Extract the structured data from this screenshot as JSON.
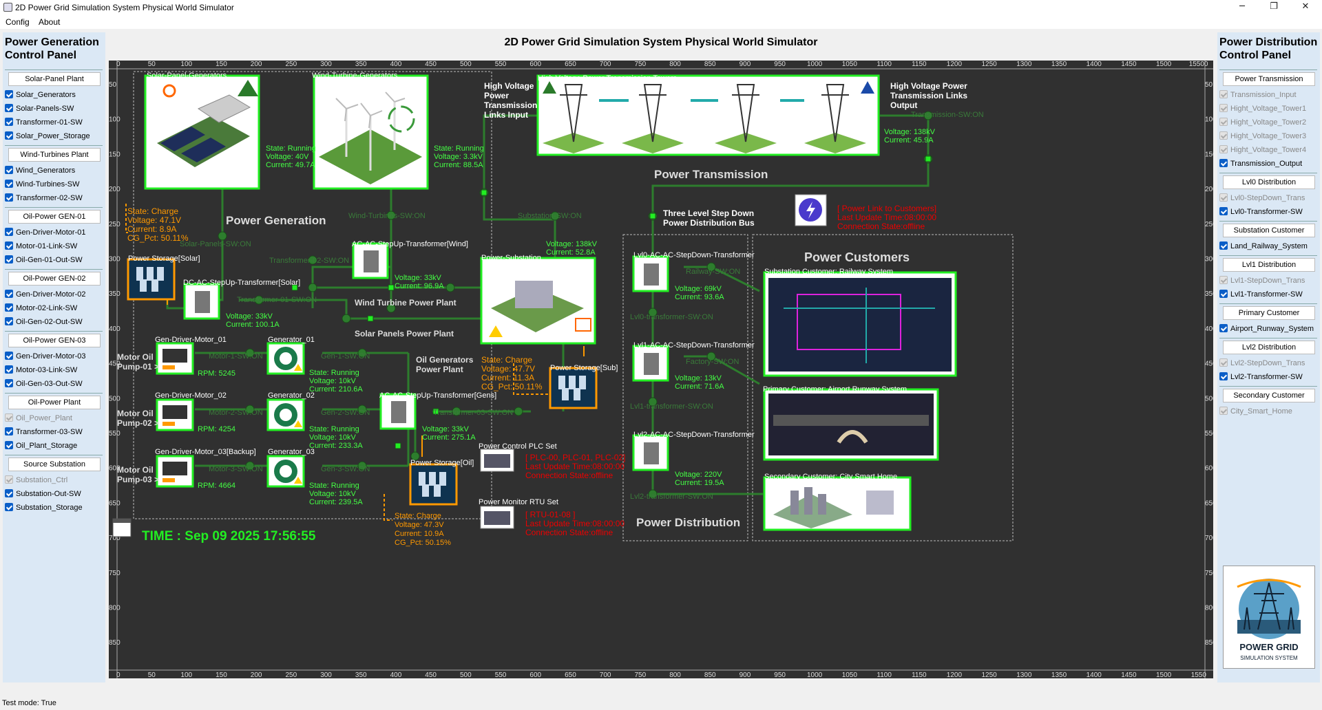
{
  "window": {
    "title": "2D Power Grid Simulation System Physical World Simulator",
    "min": "─",
    "max": "❐",
    "close": "✕"
  },
  "menu": [
    "Config",
    "About"
  ],
  "main_title": "2D Power Grid Simulation System Physical World Simulator",
  "left_panel": {
    "title_line1": "Power Generation",
    "title_line2": "Control Panel",
    "groups": [
      {
        "button": "Solar-Panel Plant",
        "items": [
          {
            "label": "Solar_Generators",
            "state": "on"
          },
          {
            "label": "Solar-Panels-SW",
            "state": "on"
          },
          {
            "label": "Transformer-01-SW",
            "state": "on"
          },
          {
            "label": "Solar_Power_Storage",
            "state": "on"
          }
        ]
      },
      {
        "button": "Wind-Turbines Plant",
        "items": [
          {
            "label": "Wind_Generators",
            "state": "on"
          },
          {
            "label": "Wind-Turbines-SW",
            "state": "on"
          },
          {
            "label": "Transformer-02-SW",
            "state": "on"
          }
        ]
      },
      {
        "button": "Oil-Power GEN-01",
        "items": [
          {
            "label": "Gen-Driver-Motor-01",
            "state": "on"
          },
          {
            "label": "Motor-01-Link-SW",
            "state": "on"
          },
          {
            "label": "Oil-Gen-01-Out-SW",
            "state": "on"
          }
        ]
      },
      {
        "button": "Oil-Power GEN-02",
        "items": [
          {
            "label": "Gen-Driver-Motor-02",
            "state": "on"
          },
          {
            "label": "Motor-02-Link-SW",
            "state": "on"
          },
          {
            "label": "Oil-Gen-02-Out-SW",
            "state": "on"
          }
        ]
      },
      {
        "button": "Oil-Power GEN-03",
        "items": [
          {
            "label": "Gen-Driver-Motor-03",
            "state": "on"
          },
          {
            "label": "Motor-03-Link-SW",
            "state": "on"
          },
          {
            "label": "Oil-Gen-03-Out-SW",
            "state": "on"
          }
        ]
      },
      {
        "button": "Oil-Power Plant",
        "items": [
          {
            "label": "Oil_Power_Plant",
            "state": "dis"
          },
          {
            "label": "Transformer-03-SW",
            "state": "on"
          },
          {
            "label": "Oil_Plant_Storage",
            "state": "on"
          }
        ]
      },
      {
        "button": "Source Substation",
        "items": [
          {
            "label": "Substation_Ctrl",
            "state": "dis"
          },
          {
            "label": "Substation-Out-SW",
            "state": "on"
          },
          {
            "label": "Substation_Storage",
            "state": "on"
          }
        ]
      }
    ]
  },
  "right_panel": {
    "title_line1": "Power Distribution",
    "title_line2": "Control Panel",
    "logo_line1": "POWER GRID",
    "logo_line2": "SIMULATION SYSTEM",
    "groups": [
      {
        "button": "Power Transmission",
        "items": [
          {
            "label": "Transmission_Input",
            "state": "dis"
          },
          {
            "label": "Hight_Voltage_Tower1",
            "state": "dis"
          },
          {
            "label": "Hight_Voltage_Tower2",
            "state": "dis"
          },
          {
            "label": "Hight_Voltage_Tower3",
            "state": "dis"
          },
          {
            "label": "Hight_Voltage_Tower4",
            "state": "dis"
          },
          {
            "label": "Transmission_Output",
            "state": "on"
          }
        ]
      },
      {
        "button": "Lvl0 Distribution",
        "items": [
          {
            "label": "Lvl0-StepDown_Trans",
            "state": "dis"
          },
          {
            "label": "Lvl0-Transformer-SW",
            "state": "on"
          }
        ]
      },
      {
        "button": "Substation Customer",
        "items": [
          {
            "label": "Land_Railway_System",
            "state": "on"
          }
        ]
      },
      {
        "button": "Lvl1 Distribution",
        "items": [
          {
            "label": "Lvl1-StepDown_Trans",
            "state": "dis"
          },
          {
            "label": "Lvl1-Transformer-SW",
            "state": "on"
          }
        ]
      },
      {
        "button": "Primary Customer",
        "items": [
          {
            "label": "Airport_Runway_System",
            "state": "on"
          }
        ]
      },
      {
        "button": "Lvl2 Distribution",
        "items": [
          {
            "label": "Lvl2-StepDown_Trans",
            "state": "dis"
          },
          {
            "label": "Lvl2-Transformer-SW",
            "state": "on"
          }
        ]
      },
      {
        "button": "Secondary Customer",
        "items": [
          {
            "label": "City_Smart_Home",
            "state": "dis"
          }
        ]
      }
    ]
  },
  "ruler": {
    "top": [
      "0",
      "50",
      "100",
      "150",
      "200",
      "250",
      "300",
      "350",
      "400",
      "450",
      "500",
      "550",
      "600",
      "650",
      "700",
      "750",
      "800",
      "850",
      "900",
      "950",
      "1000",
      "1050",
      "1100",
      "1150",
      "1200",
      "1250",
      "1300",
      "1350",
      "1400",
      "1450",
      "1500",
      "15500"
    ],
    "bottom": [
      "0",
      "50",
      "100",
      "150",
      "200",
      "250",
      "300",
      "350",
      "400",
      "450",
      "500",
      "550",
      "600",
      "650",
      "700",
      "750",
      "800",
      "850",
      "900",
      "950",
      "1000",
      "1050",
      "1100",
      "1150",
      "1200",
      "1250",
      "1300",
      "1350",
      "1400",
      "1450",
      "1500",
      "1550"
    ],
    "y": [
      "50",
      "100",
      "150",
      "200",
      "250",
      "300",
      "350",
      "400",
      "450",
      "500",
      "550",
      "600",
      "650",
      "700",
      "750",
      "800",
      "850"
    ]
  },
  "texts": [
    [
      "Solar-Panel-Generators",
      55,
      15,
      11,
      "#fff",
      "normal"
    ],
    [
      "Wind-Turbine-Generators",
      295,
      15,
      11,
      "#fff",
      "normal"
    ],
    [
      "High Voltage Power Transmission Towers",
      623,
      19,
      11,
      "#fff",
      "normal"
    ],
    [
      "High Voltage",
      545,
      30,
      12,
      "#fff",
      "bold"
    ],
    [
      "Power",
      545,
      44,
      12,
      "#fff",
      "bold"
    ],
    [
      "Transmission",
      545,
      58,
      12,
      "#fff",
      "bold"
    ],
    [
      "Links Input",
      545,
      72,
      12,
      "#fff",
      "bold"
    ],
    [
      "High Voltage Power",
      1135,
      30,
      12,
      "#fff",
      "bold"
    ],
    [
      "Transmission Links",
      1135,
      44,
      12,
      "#fff",
      "bold"
    ],
    [
      "Output",
      1135,
      58,
      12,
      "#fff",
      "bold"
    ],
    [
      "Transmission-SW:ON",
      1165,
      72,
      11,
      "#3a7a3a",
      "normal"
    ],
    [
      "Voltage: 138kV",
      1126,
      97,
      11,
      "#4f4",
      "normal"
    ],
    [
      "Current: 45.9A",
      1126,
      109,
      11,
      "#4f4",
      "normal"
    ],
    [
      "Power Transmission",
      792,
      155,
      17,
      "#ddd",
      "bold"
    ],
    [
      "State: Running",
      228,
      121,
      11,
      "#4f4",
      "normal"
    ],
    [
      "Voltage: 40V",
      228,
      133,
      11,
      "#4f4",
      "normal"
    ],
    [
      "Current: 49.7A",
      228,
      145,
      11,
      "#4f4",
      "normal"
    ],
    [
      "State: Running",
      472,
      121,
      11,
      "#4f4",
      "normal"
    ],
    [
      "Voltage: 3.3kV",
      472,
      133,
      11,
      "#4f4",
      "normal"
    ],
    [
      "Current: 88.5A",
      472,
      145,
      11,
      "#4f4",
      "normal"
    ],
    [
      "State: Charge",
      27,
      212,
      12,
      "#f90",
      "normal"
    ],
    [
      "Voltage: 47.1V",
      27,
      225,
      12,
      "#f90",
      "normal"
    ],
    [
      "Current: 8.9A",
      27,
      238,
      12,
      "#f90",
      "normal"
    ],
    [
      "CG_Pct: 50.11%",
      27,
      251,
      12,
      "#f90",
      "normal"
    ],
    [
      "Power Generation",
      170,
      222,
      17,
      "#ddd",
      "bold"
    ],
    [
      "Wind-Turbines-SW:ON",
      348,
      219,
      11,
      "#3a7a3a",
      "normal"
    ],
    [
      "Substation-SW:ON",
      594,
      219,
      11,
      "#3a7a3a",
      "normal"
    ],
    [
      "Three Level Step Down",
      805,
      215,
      12,
      "#fff",
      "bold"
    ],
    [
      "Power Distribution Bus",
      805,
      229,
      12,
      "#fff",
      "bold"
    ],
    [
      "[ Power Link to Customers]",
      1058,
      208,
      12,
      "#e00",
      "normal"
    ],
    [
      "Last Update Time:08:00:00",
      1058,
      221,
      12,
      "#e00",
      "normal"
    ],
    [
      "Connection State:offline",
      1058,
      234,
      12,
      "#e00",
      "normal"
    ],
    [
      "Solar-Panels-SW:ON",
      103,
      260,
      11,
      "#3a7a3a",
      "normal"
    ],
    [
      "AC-AC-StepUp-Transformer[Wind]",
      353,
      260,
      11,
      "#fff",
      "normal"
    ],
    [
      "Voltage: 138kV",
      635,
      260,
      11,
      "#4f4",
      "normal"
    ],
    [
      "Current: 52.8A",
      635,
      272,
      11,
      "#4f4",
      "normal"
    ],
    [
      "Power Customers",
      1010,
      275,
      18,
      "#ddd",
      "bold"
    ],
    [
      "Lvl0-AC-AC-StepDown-Transformer",
      762,
      276,
      11,
      "#fff",
      "normal"
    ],
    [
      "Power-Substation",
      541,
      280,
      11,
      "#fff",
      "normal"
    ],
    [
      "Transformer-02-SW:ON",
      233,
      284,
      11,
      "#3a7a3a",
      "normal"
    ],
    [
      "Power Storage[Solar]",
      28,
      281,
      11,
      "#fff",
      "normal"
    ],
    [
      "Substation Customer: Railway System",
      952,
      300,
      11,
      "#fff",
      "normal"
    ],
    [
      "Railway-SW:ON",
      838,
      300,
      11,
      "#3a7a3a",
      "normal"
    ],
    [
      "Voltage: 33kV",
      415,
      309,
      11,
      "#4f4",
      "normal"
    ],
    [
      "Current: 96.9A",
      415,
      321,
      11,
      "#4f4",
      "normal"
    ],
    [
      "Voltage: 69kV",
      822,
      325,
      11,
      "#4f4",
      "normal"
    ],
    [
      "Current: 93.6A",
      822,
      337,
      11,
      "#4f4",
      "normal"
    ],
    [
      "DC-AC-StepUp-Transformer[Solar]",
      108,
      316,
      11,
      "#fff",
      "normal"
    ],
    [
      "Transformer-01-SW:ON",
      186,
      341,
      11,
      "#3a7a3a",
      "normal"
    ],
    [
      "Wind Turbine Power Plant",
      357,
      345,
      12,
      "#ddd",
      "bold"
    ],
    [
      "Lvl0-transformer-SW:ON",
      757,
      366,
      11,
      "#3a7a3a",
      "normal"
    ],
    [
      "Voltage: 33kV",
      170,
      365,
      11,
      "#4f4",
      "normal"
    ],
    [
      "Current: 100.1A",
      170,
      377,
      11,
      "#4f4",
      "normal"
    ],
    [
      "Solar Panels Power Plant",
      357,
      390,
      12,
      "#ddd",
      "bold"
    ],
    [
      "Lvl1-AC-AC-StepDown-Transformer",
      762,
      407,
      11,
      "#fff",
      "normal"
    ],
    [
      "Gen-Driver-Motor_01",
      67,
      399,
      11,
      "#fff",
      "normal"
    ],
    [
      "Generator_01",
      231,
      399,
      11,
      "#fff",
      "normal"
    ],
    [
      "Oil Generators",
      446,
      428,
      12,
      "#ddd",
      "bold"
    ],
    [
      "Power Plant",
      446,
      442,
      12,
      "#ddd",
      "bold"
    ],
    [
      "State: Charge",
      541,
      428,
      12,
      "#f90",
      "normal"
    ],
    [
      "Voltage: 47.7V",
      541,
      441,
      12,
      "#f90",
      "normal"
    ],
    [
      "Current: 11.3A",
      541,
      454,
      12,
      "#f90",
      "normal"
    ],
    [
      "CG_Pct: 50.11%",
      541,
      467,
      12,
      "#f90",
      "normal"
    ],
    [
      "Power Storage[Sub]",
      641,
      440,
      11,
      "#fff",
      "normal"
    ],
    [
      "Motor-1-SW:ON",
      145,
      423,
      11,
      "#3a7a3a",
      "normal"
    ],
    [
      "Gen-1-SW:ON",
      308,
      423,
      11,
      "#3a7a3a",
      "normal"
    ],
    [
      "Motor Oil",
      12,
      424,
      12,
      "#ddd",
      "bold"
    ],
    [
      "Pump-01 >",
      12,
      438,
      12,
      "#ddd",
      "bold"
    ],
    [
      "Factory-SW:ON",
      838,
      431,
      11,
      "#3a7a3a",
      "normal"
    ],
    [
      "RPM: 5245",
      129,
      448,
      11,
      "#4f4",
      "normal"
    ],
    [
      "State: Running",
      291,
      447,
      11,
      "#4f4",
      "normal"
    ],
    [
      "Voltage: 10kV",
      291,
      459,
      11,
      "#4f4",
      "normal"
    ],
    [
      "Current: 210.6A",
      291,
      471,
      11,
      "#4f4",
      "normal"
    ],
    [
      "Voltage: 13kV",
      822,
      455,
      11,
      "#4f4",
      "normal"
    ],
    [
      "Current: 71.6A",
      822,
      467,
      11,
      "#4f4",
      "normal"
    ],
    [
      "Primary Customer: Airport Runway System",
      950,
      471,
      11,
      "#fff",
      "normal"
    ],
    [
      "Gen-Driver-Motor_02",
      67,
      480,
      11,
      "#fff",
      "normal"
    ],
    [
      "Generator_02",
      231,
      480,
      11,
      "#fff",
      "normal"
    ],
    [
      "AC-AC-StepUp-Transformer[Gens]",
      393,
      480,
      11,
      "#fff",
      "normal"
    ],
    [
      "Lvl1-transformer-SW:ON",
      757,
      496,
      11,
      "#3a7a3a",
      "normal"
    ],
    [
      "Motor Oil",
      12,
      506,
      12,
      "#ddd",
      "bold"
    ],
    [
      "Pump-02 >",
      12,
      520,
      12,
      "#ddd",
      "bold"
    ],
    [
      "Motor-2-SW:ON",
      145,
      505,
      11,
      "#3a7a3a",
      "normal"
    ],
    [
      "Gen-2-SW:ON",
      308,
      505,
      11,
      "#3a7a3a",
      "normal"
    ],
    [
      "Transformer-03-SW:ON",
      471,
      505,
      11,
      "#3a7a3a",
      "normal"
    ],
    [
      "RPM: 4254",
      129,
      529,
      11,
      "#4f4",
      "normal"
    ],
    [
      "State: Running",
      291,
      529,
      11,
      "#4f4",
      "normal"
    ],
    [
      "Voltage: 10kV",
      291,
      541,
      11,
      "#4f4",
      "normal"
    ],
    [
      "Current: 233.3A",
      291,
      553,
      11,
      "#4f4",
      "normal"
    ],
    [
      "Voltage: 33kV",
      455,
      529,
      11,
      "#4f4",
      "normal"
    ],
    [
      "Current: 275.1A",
      455,
      541,
      11,
      "#4f4",
      "normal"
    ],
    [
      "Lvl2-AC-AC-StepDown-Transformer",
      762,
      537,
      11,
      "#fff",
      "normal"
    ],
    [
      "Power Control PLC Set",
      537,
      554,
      11,
      "#fff",
      "normal"
    ],
    [
      "Gen-Driver-Motor_03[Backup]",
      67,
      562,
      11,
      "#fff",
      "normal"
    ],
    [
      "Generator_03",
      231,
      562,
      11,
      "#fff",
      "normal"
    ],
    [
      "[ PLC-00, PLC-01, PLC-02]",
      605,
      570,
      12,
      "#e00",
      "normal"
    ],
    [
      "Last Update Time:08:00:00",
      605,
      583,
      12,
      "#e00",
      "normal"
    ],
    [
      "Connection State:offline",
      605,
      596,
      12,
      "#e00",
      "normal"
    ],
    [
      "Power Storage[Oil]",
      438,
      578,
      11,
      "#fff",
      "normal"
    ],
    [
      "Motor Oil",
      12,
      588,
      12,
      "#ddd",
      "bold"
    ],
    [
      "Pump-03 >",
      12,
      602,
      12,
      "#ddd",
      "bold"
    ],
    [
      "Motor-3-SW:ON",
      145,
      587,
      11,
      "#3a7a3a",
      "normal"
    ],
    [
      "Gen-3-SW:ON",
      308,
      587,
      11,
      "#3a7a3a",
      "normal"
    ],
    [
      "Voltage: 220V",
      822,
      595,
      11,
      "#4f4",
      "normal"
    ],
    [
      "Current: 19.5A",
      822,
      607,
      11,
      "#4f4",
      "normal"
    ],
    [
      "Secondary Customer: City Smart Home",
      952,
      598,
      11,
      "#fff",
      "normal"
    ],
    [
      "RPM: 4664",
      129,
      611,
      11,
      "#4f4",
      "normal"
    ],
    [
      "State: Running",
      291,
      611,
      11,
      "#4f4",
      "normal"
    ],
    [
      "Voltage: 10kV",
      291,
      623,
      11,
      "#4f4",
      "normal"
    ],
    [
      "Current: 239.5A",
      291,
      635,
      11,
      "#4f4",
      "normal"
    ],
    [
      "Power Monitor RTU Set",
      537,
      635,
      11,
      "#fff",
      "normal"
    ],
    [
      "Lvl2-transformer-SW:ON",
      757,
      627,
      11,
      "#3a7a3a",
      "normal"
    ],
    [
      "[ RTU-01-08 ]",
      605,
      653,
      12,
      "#e00",
      "normal"
    ],
    [
      "Last Update Time:08:00:00",
      605,
      666,
      12,
      "#e00",
      "normal"
    ],
    [
      "Connection State:offline",
      605,
      679,
      12,
      "#e00",
      "normal"
    ],
    [
      "State: Charge",
      415,
      655,
      11,
      "#f90",
      "normal"
    ],
    [
      "Voltage: 47.3V",
      415,
      668,
      11,
      "#f90",
      "normal"
    ],
    [
      "Current: 10.9A",
      415,
      681,
      11,
      "#f90",
      "normal"
    ],
    [
      "CG_Pct: 50.15%",
      415,
      694,
      11,
      "#f90",
      "normal"
    ],
    [
      "Power Distribution",
      766,
      661,
      17,
      "#ddd",
      "bold"
    ],
    [
      "TIME : Sep 09 2025 17:56:55",
      48,
      679,
      19,
      "#2e2",
      "bold"
    ]
  ],
  "status": "Test mode: True"
}
